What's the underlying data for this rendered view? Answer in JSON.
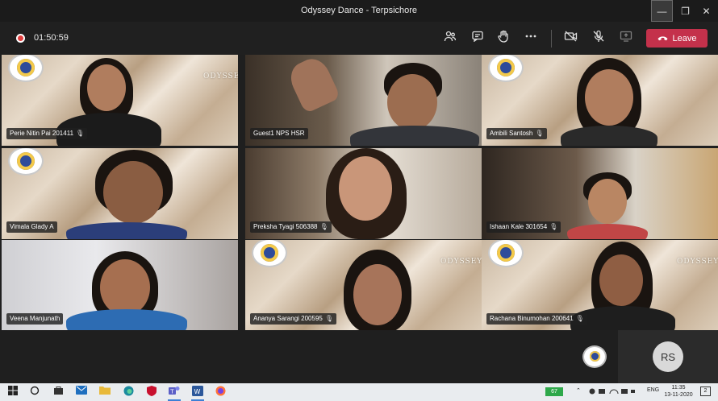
{
  "window": {
    "title": "Odyssey Dance - Terpsichore",
    "minimize": "—",
    "maximize": "❐",
    "close": "✕"
  },
  "meeting": {
    "timer": "01:50:59",
    "controls": {
      "people_icon": "people-icon",
      "chat_icon": "chat-icon",
      "raise_hand_icon": "raise-hand-icon",
      "more_icon": "more-options-icon",
      "camera_icon": "camera-off-icon",
      "mic_icon": "mic-off-icon",
      "share_icon": "share-screen-icon",
      "leave_label": "Leave"
    }
  },
  "participants": [
    {
      "name": "Perie Nitin Pai 201411",
      "bg": "marble",
      "logo": true,
      "watermark": "ODYSSEY"
    },
    {
      "name": "Guest1 NPS HSR",
      "bg": "room1",
      "logo": false,
      "watermark": ""
    },
    {
      "name": "Ambili Santosh",
      "bg": "marble",
      "logo": true,
      "watermark": ""
    },
    {
      "name": "Vimala Glady A",
      "bg": "marble",
      "logo": true,
      "watermark": ""
    },
    {
      "name": "Preksha Tyagi 506388",
      "bg": "room2",
      "logo": false,
      "watermark": ""
    },
    {
      "name": "Ishaan Kale 301654",
      "bg": "room3",
      "logo": false,
      "watermark": ""
    },
    {
      "name": "Veena Manjunath",
      "bg": "room4",
      "logo": false,
      "watermark": ""
    },
    {
      "name": "Ananya Sarangi 200595",
      "bg": "marble",
      "logo": true,
      "watermark": "ODYSSEY"
    },
    {
      "name": "Rachana Binumohan 200641",
      "bg": "marble",
      "logo": true,
      "watermark": "ODYSSEY"
    }
  ],
  "self_view": {
    "initials": "RS"
  },
  "taskbar": {
    "apps": [
      "windows-start-icon",
      "search-icon",
      "store-icon",
      "mail-icon",
      "file-explorer-icon",
      "edge-icon",
      "mcafee-icon",
      "teams-icon",
      "word-icon",
      "firefox-icon"
    ],
    "battery": "67",
    "language": "ENG",
    "time": "11:35",
    "date": "13-11-2020",
    "notification": "2"
  }
}
